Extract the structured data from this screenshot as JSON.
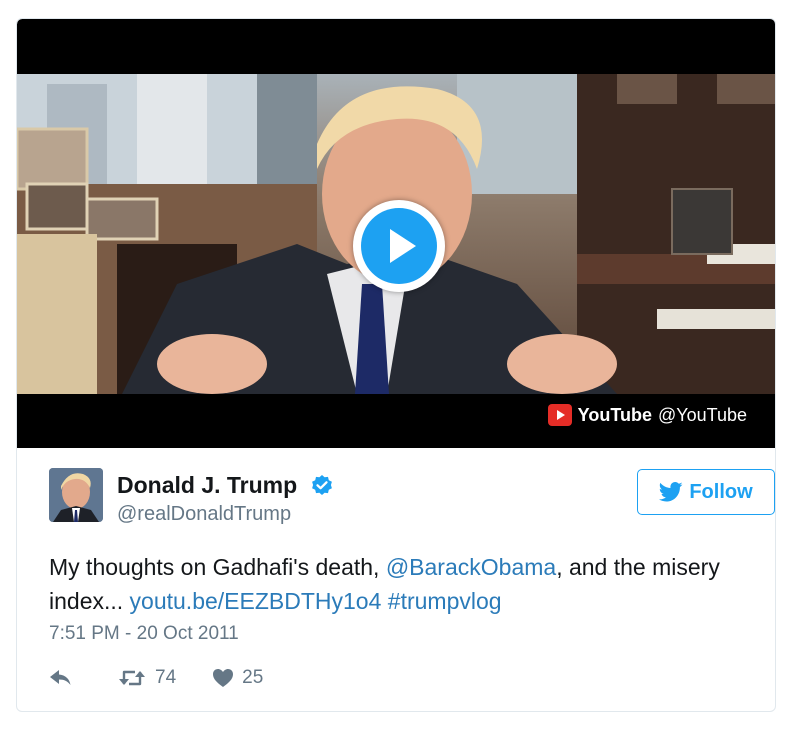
{
  "media": {
    "provider_name": "YouTube",
    "provider_handle": "@YouTube",
    "play_icon": "play-icon",
    "accent": "#1da1f2"
  },
  "author": {
    "name": "Donald J. Trump",
    "handle": "@realDonaldTrump",
    "verified": true
  },
  "follow": {
    "label": "Follow",
    "icon": "twitter-bird-icon"
  },
  "tweet": {
    "text_part1": "My thoughts on Gadhafi's death, ",
    "mention": "@BarackObama",
    "text_part2": ", and the misery index... ",
    "url": "youtu.be/EEZBDTHy1o4",
    "text_part3": " ",
    "hashtag": "#trumpvlog",
    "timestamp": "7:51 PM - 20 Oct 2011"
  },
  "actions": {
    "reply_icon": "reply-icon",
    "retweet_count": "74",
    "like_count": "25"
  },
  "colors": {
    "link": "#2b7bb9",
    "secondary_text": "#657786",
    "youtube_red": "#e52d27"
  }
}
